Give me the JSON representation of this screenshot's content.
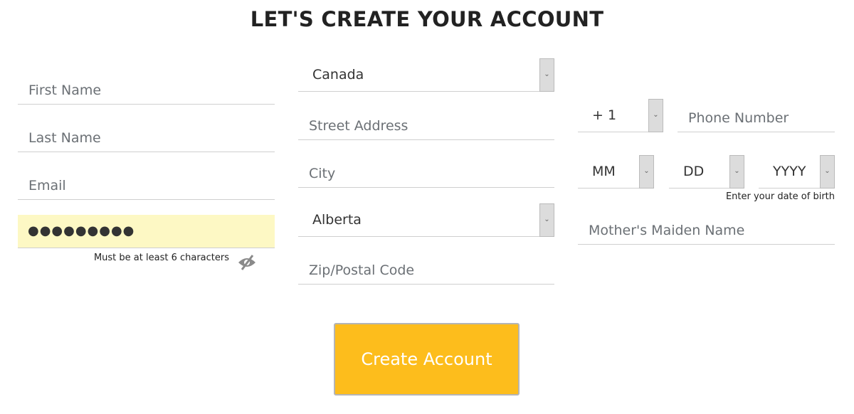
{
  "title": "LET'S CREATE YOUR ACCOUNT",
  "fields": {
    "first_name": {
      "placeholder": "First Name"
    },
    "last_name": {
      "placeholder": "Last Name"
    },
    "email": {
      "placeholder": "Email"
    },
    "password": {
      "value": "●●●●●●●●●",
      "helper": "Must be at least 6 characters"
    },
    "country": {
      "value": "Canada"
    },
    "street": {
      "placeholder": "Street Address"
    },
    "city": {
      "placeholder": "City"
    },
    "province": {
      "value": "Alberta"
    },
    "zip": {
      "placeholder": "Zip/Postal Code"
    },
    "phone_code": {
      "value": "+ 1"
    },
    "phone": {
      "placeholder": "Phone Number"
    },
    "dob_month": {
      "value": "MM"
    },
    "dob_day": {
      "value": "DD"
    },
    "dob_year": {
      "value": "YYYY"
    },
    "dob_helper": "Enter your date of birth",
    "maiden_name": {
      "placeholder": "Mother's Maiden Name"
    }
  },
  "icons": {
    "password_toggle": "eye-slash-icon",
    "chevron": "chevron-down-icon"
  },
  "colors": {
    "button": "#fdbd1c",
    "password_bg": "#fdf8c4"
  },
  "submit_label": "Create Account"
}
